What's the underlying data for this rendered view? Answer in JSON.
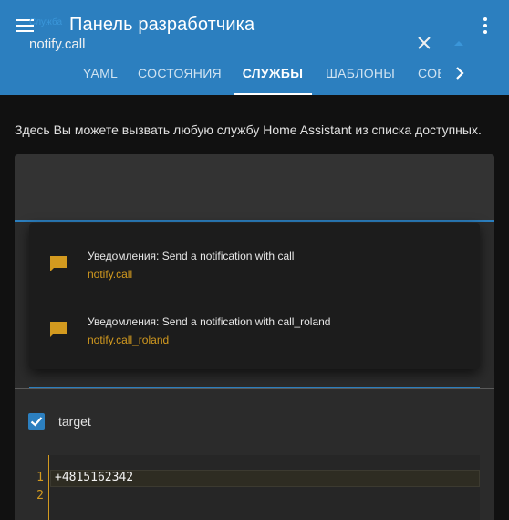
{
  "header": {
    "title": "Панель разработчика",
    "tabs": [
      {
        "label": "YAML"
      },
      {
        "label": "СОСТОЯНИЯ"
      },
      {
        "label": "СЛУЖБЫ"
      },
      {
        "label": "ШАБЛОНЫ"
      },
      {
        "label": "СОБЫТИЯ"
      }
    ],
    "active_tab": "СЛУЖБЫ"
  },
  "main": {
    "description": "Здесь Вы можете вызвать любую службу Home Assistant из списка доступных.",
    "service_field": {
      "label": "Служба",
      "value": "notify.call"
    },
    "suggestions": [
      {
        "title": "Уведомления: Send a notification with call",
        "service": "notify.call",
        "icon": "message-icon"
      },
      {
        "title": "Уведомления: Send a notification with call_roland",
        "service": "notify.call_roland",
        "icon": "message-icon"
      }
    ],
    "target_checkbox": {
      "label": "target",
      "checked": true
    },
    "editor": {
      "line_numbers": [
        "1",
        "2"
      ],
      "lines": [
        "+4815162342",
        ""
      ]
    }
  },
  "colors": {
    "header_bg": "#2c7fbf",
    "accent_blue": "#2c7fbf",
    "accent_gold": "#d39a1f",
    "page_bg": "#111111"
  },
  "icons": [
    "menu-icon",
    "overflow-menu-icon",
    "chevron-right-icon",
    "close-icon",
    "caret-up-icon",
    "message-icon",
    "checkmark-icon"
  ]
}
